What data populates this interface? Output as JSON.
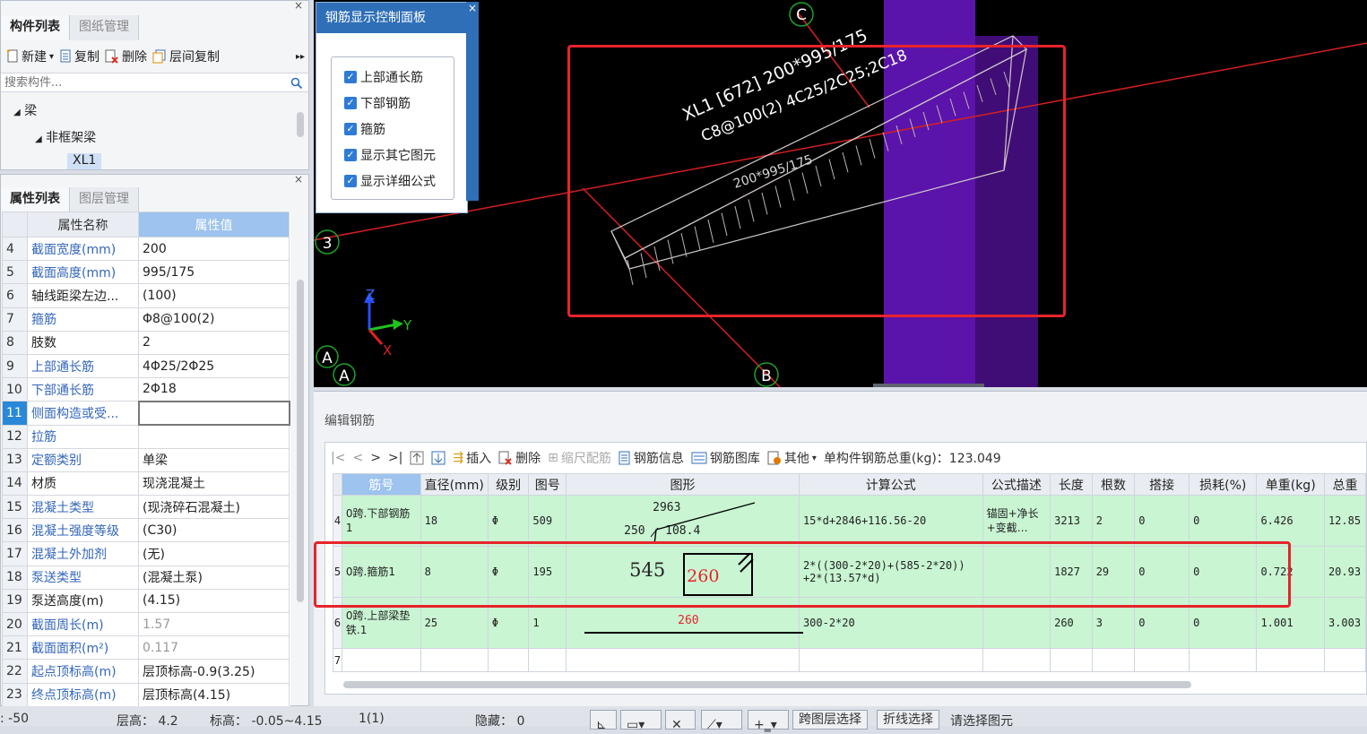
{
  "component_panel": {
    "tabs": [
      "构件列表",
      "图纸管理"
    ],
    "toolbar": {
      "new": "新建",
      "copy": "复制",
      "delete": "删除",
      "floor_copy": "层间复制"
    },
    "search_placeholder": "搜索构件...",
    "tree": {
      "root": "梁",
      "child": "非框架梁",
      "leaf": "XL1"
    }
  },
  "property_panel": {
    "tabs": [
      "属性列表",
      "图层管理"
    ],
    "headers": {
      "name": "属性名称",
      "value": "属性值"
    },
    "rows": [
      {
        "num": "4",
        "name": "截面宽度(mm)",
        "value": "200"
      },
      {
        "num": "5",
        "name": "截面高度(mm)",
        "value": "995/175"
      },
      {
        "num": "6",
        "name": "轴线距梁左边...",
        "value": "(100)"
      },
      {
        "num": "7",
        "name": "箍筋",
        "value": "Φ8@100(2)"
      },
      {
        "num": "8",
        "name": "肢数",
        "value": "2"
      },
      {
        "num": "9",
        "name": "上部通长筋",
        "value": "4Φ25/2Φ25"
      },
      {
        "num": "10",
        "name": "下部通长筋",
        "value": "2Φ18"
      },
      {
        "num": "11",
        "name": "侧面构造或受...",
        "value": ""
      },
      {
        "num": "12",
        "name": "拉筋",
        "value": ""
      },
      {
        "num": "13",
        "name": "定额类别",
        "value": "单梁"
      },
      {
        "num": "14",
        "name": "材质",
        "value": "现浇混凝土"
      },
      {
        "num": "15",
        "name": "混凝土类型",
        "value": "(现浇碎石混凝土)"
      },
      {
        "num": "16",
        "name": "混凝土强度等级",
        "value": "(C30)"
      },
      {
        "num": "17",
        "name": "混凝土外加剂",
        "value": "(无)"
      },
      {
        "num": "18",
        "name": "泵送类型",
        "value": "(混凝土泵)"
      },
      {
        "num": "19",
        "name": "泵送高度(m)",
        "value": "(4.15)"
      },
      {
        "num": "20",
        "name": "截面周长(m)",
        "value": "1.57"
      },
      {
        "num": "21",
        "name": "截面面积(m²)",
        "value": "0.117"
      },
      {
        "num": "22",
        "name": "起点顶标高(m)",
        "value": "层顶标高-0.9(3.25)"
      },
      {
        "num": "23",
        "name": "终点顶标高(m)",
        "value": "层顶标高(4.15)"
      }
    ]
  },
  "control_panel": {
    "title": "钢筋显示控制面板",
    "items": [
      "上部通长筋",
      "下部钢筋",
      "箍筋",
      "显示其它图元",
      "显示详细公式"
    ]
  },
  "viewport": {
    "axis_labels": {
      "c": "C",
      "three": "3",
      "a1": "A",
      "a2": "A",
      "b": "B"
    },
    "beam_label_1": "XL1 [672] 200*995/175",
    "beam_label_2": "C8@100(2) 4C25/2C25;2C18",
    "beam_label_3": "200*995/175",
    "gizmo": {
      "z": "Z",
      "y": "Y",
      "x": "X"
    }
  },
  "edit_rebar": {
    "title": "编辑钢筋",
    "toolbar": {
      "insert": "插入",
      "delete": "删除",
      "scale": "缩尺配筋",
      "info": "钢筋信息",
      "library": "钢筋图库",
      "other": "其他",
      "total": "单构件钢筋总重(kg)：123.049"
    },
    "headers": [
      "筋号",
      "直径(mm)",
      "级别",
      "图号",
      "图形",
      "计算公式",
      "公式描述",
      "长度",
      "根数",
      "搭接",
      "损耗(%)",
      "单重(kg)",
      "总重"
    ],
    "rows": [
      {
        "rn": "4",
        "name": "0跨.下部钢筋1",
        "dia": "18",
        "grade": "Φ",
        "fig": "509",
        "shape_a": "2963",
        "shape_b": "250",
        "shape_c": "108.4",
        "formula": "15*d+2846+116.56-20",
        "desc": "锚固+净长+变截…",
        "len": "3213",
        "count": "2",
        "lap": "0",
        "loss": "0",
        "unit": "6.426",
        "total": "12.85"
      },
      {
        "rn": "5",
        "name": "0跨.箍筋1",
        "dia": "8",
        "grade": "Φ",
        "fig": "195",
        "shape_a": "545",
        "shape_b": "260",
        "formula": "2*((300-2*20)+(585-2*20))\n+2*(13.57*d)",
        "desc": "",
        "len": "1827",
        "count": "29",
        "lap": "0",
        "loss": "0",
        "unit": "0.722",
        "total": "20.93"
      },
      {
        "rn": "6",
        "name": "0跨.上部梁垫铁.1",
        "dia": "25",
        "grade": "Φ",
        "fig": "1",
        "shape_a": "260",
        "formula": "300-2*20",
        "desc": "",
        "len": "260",
        "count": "3",
        "lap": "0",
        "loss": "0",
        "unit": "1.001",
        "total": "3.003"
      },
      {
        "rn": "7"
      }
    ]
  },
  "status_bar": {
    "left": ": -50",
    "floor_height": "层高：  4.2",
    "elevation": "标高：  -0.05~4.15",
    "count": "1(1)",
    "hidden": "隐藏：  0",
    "cross_floor": "跨图层选择",
    "polyline": "折线选择",
    "prompt": "请选择图元"
  },
  "colors": {
    "accent": "#2f6fb8",
    "highlight_box": "#e8232b",
    "row_green": "#c9f5d2",
    "purple_column": "#7b1fd6"
  }
}
